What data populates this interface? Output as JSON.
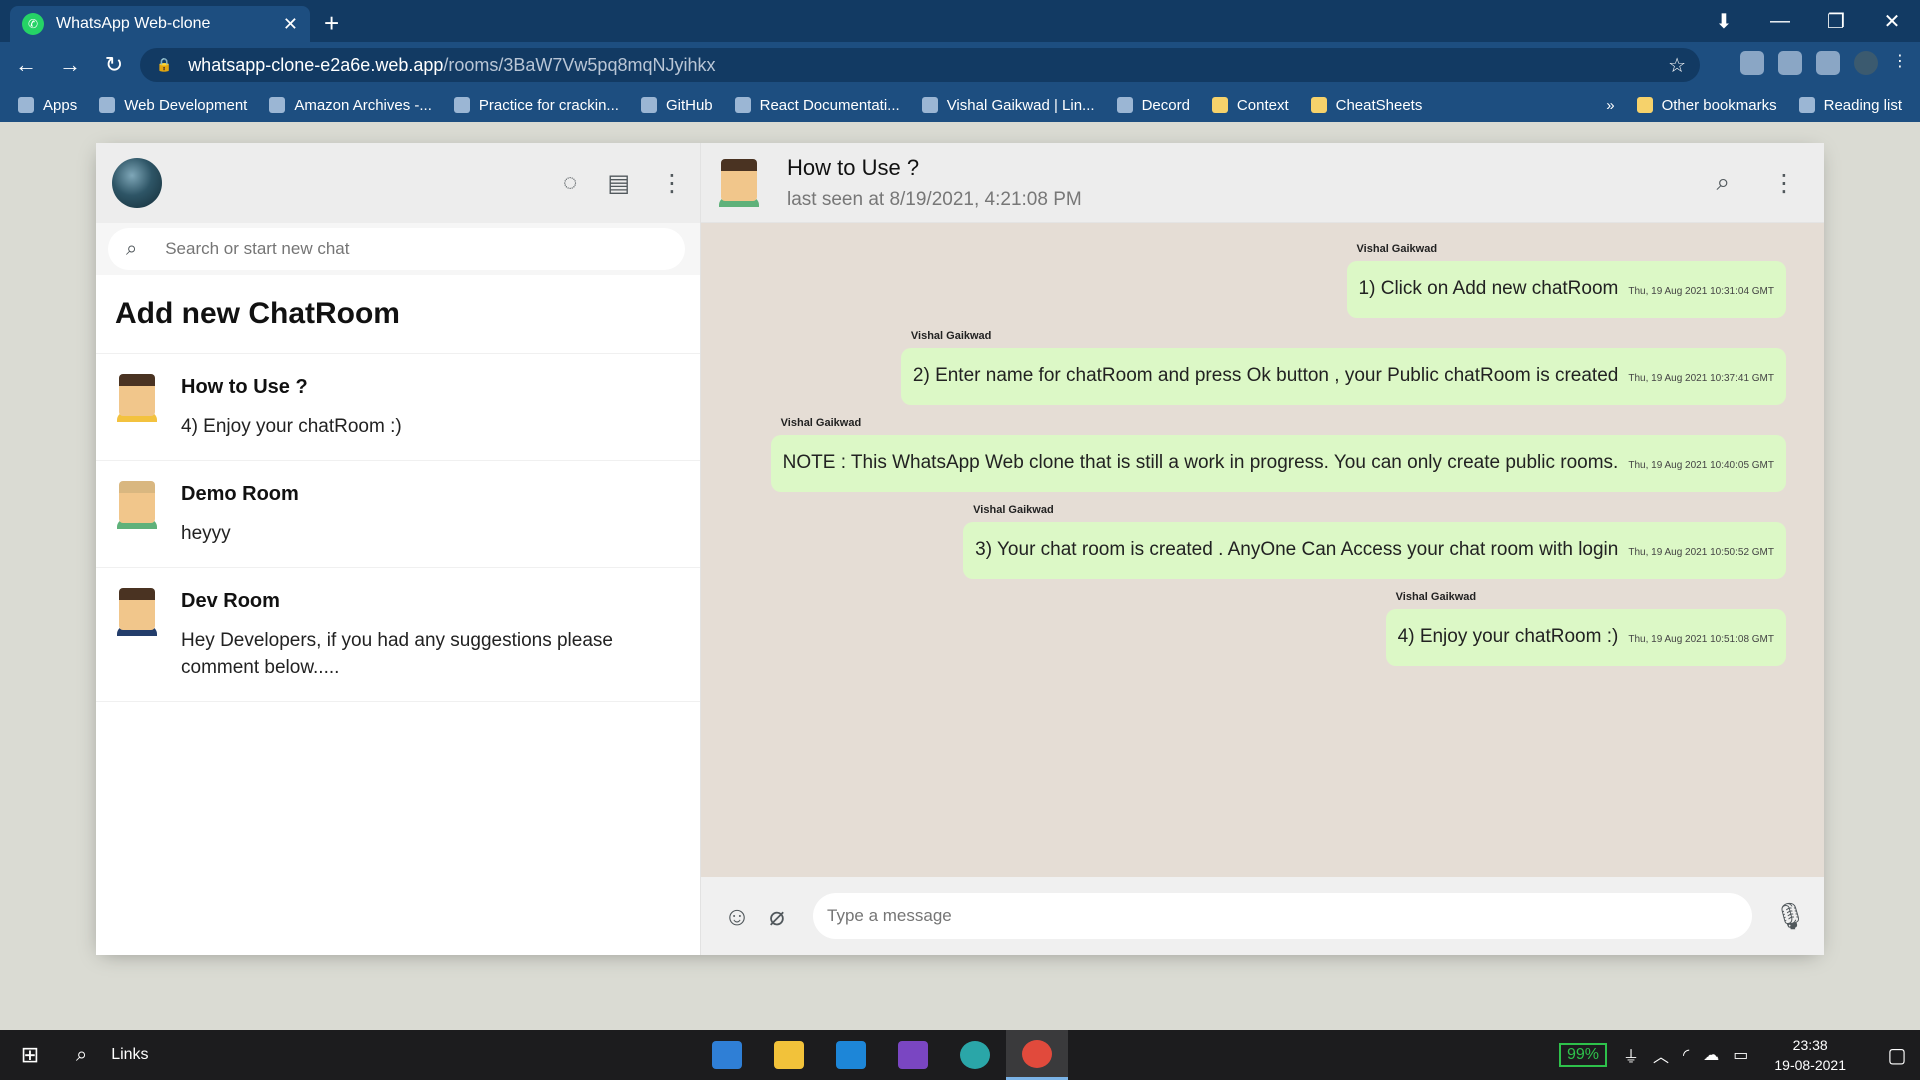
{
  "browser": {
    "tab_title": "WhatsApp Web-clone",
    "url_host": "whatsapp-clone-e2a6e.web.app",
    "url_path": "/rooms/3BaW7Vw5pq8mqNJyihkx",
    "bookmarks": [
      "Apps",
      "Web Development",
      "Amazon Archives -...",
      "Practice for crackin...",
      "GitHub",
      "React Documentati...",
      "Vishal Gaikwad | Lin...",
      "Decord",
      "Context",
      "CheatSheets"
    ],
    "more_bookmarks": "»",
    "other_bookmarks": "Other bookmarks",
    "reading_list": "Reading list"
  },
  "sidebar": {
    "search_placeholder": "Search or start new chat",
    "add_room_label": "Add new ChatRoom",
    "chats": [
      {
        "name": "How to Use ?",
        "last_message": "4) Enjoy your chatRoom :)"
      },
      {
        "name": "Demo Room",
        "last_message": "heyyy"
      },
      {
        "name": "Dev Room",
        "last_message": "Hey Developers, if you had any suggestions please comment below....."
      }
    ]
  },
  "chat": {
    "title": "How to Use ?",
    "last_seen": "last seen at 8/19/2021, 4:21:08 PM",
    "messages": [
      {
        "sender": "Vishal Gaikwad",
        "text": "1) Click on Add new chatRoom",
        "time": "Thu, 19 Aug 2021 10:31:04 GMT"
      },
      {
        "sender": "Vishal Gaikwad",
        "text": "2) Enter name for chatRoom and press Ok button , your Public chatRoom is created",
        "time": "Thu, 19 Aug 2021 10:37:41 GMT"
      },
      {
        "sender": "Vishal Gaikwad",
        "text": "NOTE : This WhatsApp Web clone that is still a work in progress. You can only create public rooms.",
        "time": "Thu, 19 Aug 2021 10:40:05 GMT"
      },
      {
        "sender": "Vishal Gaikwad",
        "text": "3) Your chat room is created . AnyOne Can Access your chat room with login",
        "time": "Thu, 19 Aug 2021 10:50:52 GMT"
      },
      {
        "sender": "Vishal Gaikwad",
        "text": "4) Enjoy your chatRoom :)",
        "time": "Thu, 19 Aug 2021 10:51:08 GMT"
      }
    ],
    "input_placeholder": "Type a message"
  },
  "taskbar": {
    "search_label": "Links",
    "battery": "99%",
    "time": "23:38",
    "date": "19-08-2021"
  },
  "colors": {
    "bubble": "#dcf8c6",
    "chat_bg": "#e5ddd5",
    "header_bg": "#ededed",
    "browser_bg": "#1d4e80"
  }
}
